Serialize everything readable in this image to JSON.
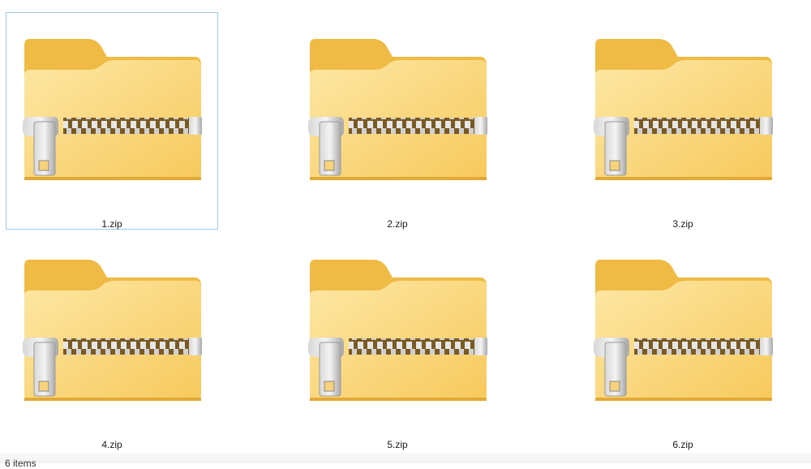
{
  "files": [
    {
      "name": "1.zip",
      "icon": "zip-folder-icon",
      "selected": true
    },
    {
      "name": "2.zip",
      "icon": "zip-folder-icon",
      "selected": false
    },
    {
      "name": "3.zip",
      "icon": "zip-folder-icon",
      "selected": false
    },
    {
      "name": "4.zip",
      "icon": "zip-folder-icon",
      "selected": false
    },
    {
      "name": "5.zip",
      "icon": "zip-folder-icon",
      "selected": false
    },
    {
      "name": "6.zip",
      "icon": "zip-folder-icon",
      "selected": false
    }
  ],
  "status_bar": {
    "item_count": "6 items"
  },
  "colors": {
    "selection_border": "#99c9f5",
    "folder_back": "#f0bf4c",
    "folder_front": "#fbd77f"
  }
}
